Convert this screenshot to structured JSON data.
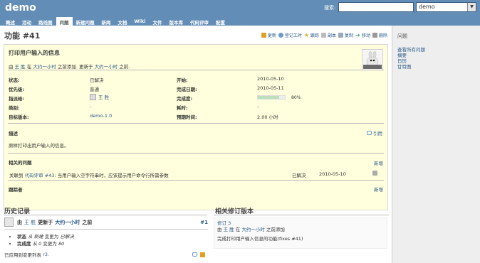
{
  "header": {
    "project": "demo",
    "search_label": "搜索:",
    "search_value": "",
    "project_select": "demo"
  },
  "menu": {
    "tabs": [
      {
        "label": "概述"
      },
      {
        "label": "活动"
      },
      {
        "label": "路线图"
      },
      {
        "label": "问题"
      },
      {
        "label": "新建问题"
      },
      {
        "label": "新闻"
      },
      {
        "label": "文档"
      },
      {
        "label": "Wiki"
      },
      {
        "label": "文件"
      },
      {
        "label": "版本库"
      },
      {
        "label": "代码评审"
      },
      {
        "label": "配置"
      }
    ]
  },
  "issue": {
    "heading": "功能 #41",
    "actions": [
      "更新",
      "登记工时",
      "跟踪",
      "副本",
      "复制",
      "移动",
      "删除"
    ],
    "subject": "打印用户输入的信息",
    "author_prefix": "由",
    "author": "王 胜",
    "added": "在",
    "added_time": "大约一小时",
    "added_suffix": "之前添加. 更新于",
    "updated_time": "大约一小时",
    "updated_suffix": "之前.",
    "attributes_left": [
      {
        "label": "状态:",
        "value": "已解决"
      },
      {
        "label": "优先级:",
        "value": "普通"
      },
      {
        "label": "指派给:",
        "value": "王 胜"
      },
      {
        "label": "类别:",
        "value": "-"
      },
      {
        "label": "目标版本:",
        "value": "demo-1.0"
      }
    ],
    "attributes_right": [
      {
        "label": "开始:",
        "value": "2010-05-10"
      },
      {
        "label": "完成日期:",
        "value": "2010-05-11"
      },
      {
        "label": "完成度:",
        "value": "80%"
      },
      {
        "label": "耗时:",
        "value": "-"
      },
      {
        "label": "预期时间:",
        "value": "2.00 小时"
      }
    ],
    "done_ratio": 0.8,
    "description_label": "描述",
    "quote_label": "引用",
    "description": "原样打印出用户输入的信息。",
    "relations_label": "相关的问题",
    "relations_new": "新增",
    "relation": {
      "prefix": "关联到",
      "link": "代码评审 #43",
      "text": ": 当用户输入空字符串时，应该提示用户命令行所需参数",
      "status": "已解决",
      "date": "2010-05-10"
    },
    "watchers_label": "跟踪者",
    "watchers_new": "新增"
  },
  "history": {
    "title": "历史记录",
    "entry": {
      "prefix": "由",
      "author": "王 胜",
      "middle": "更新于",
      "time": "大约一小时",
      "suffix": "之前",
      "number": "#1",
      "changes": [
        {
          "label": "状态",
          "from": "从 新建",
          "to": "变更为",
          "value": "已解决"
        },
        {
          "label": "完成度",
          "from": "从 0",
          "to": "变更为",
          "value": "80"
        }
      ],
      "note_prefix": "已应用到变更列表",
      "note_link": "r3."
    }
  },
  "revisions": {
    "title": "相关修订版本",
    "revision": "修订 3",
    "prefix": "由",
    "author": "王 胜",
    "middle": "在",
    "time": "大约一小时",
    "suffix": "之前添加",
    "message": "完成打印用户输入信息的功能(fixes #41)"
  },
  "sidebar": {
    "title": "问题",
    "links": [
      "查看所有问题",
      "摘要",
      "日历",
      "甘特图"
    ]
  }
}
